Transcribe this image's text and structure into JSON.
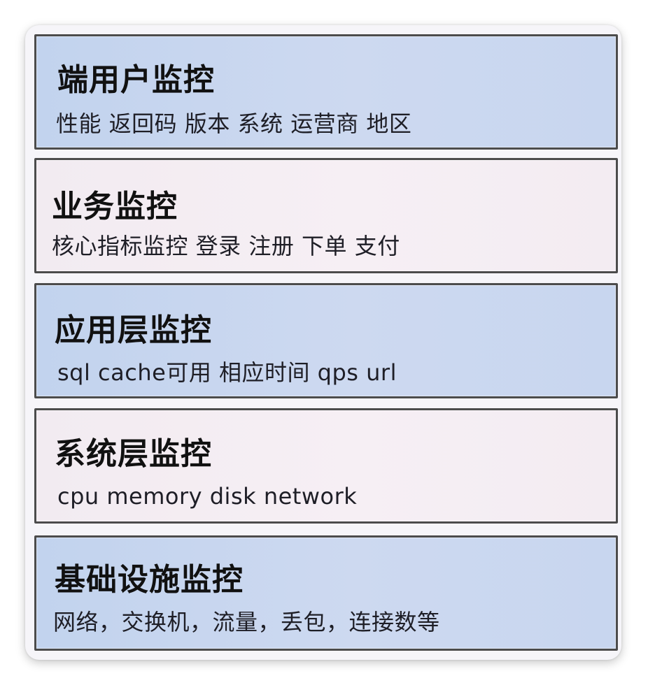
{
  "layers": [
    {
      "title": "端用户监控",
      "desc": "性能 返回码 版本 系统 运营商 地区",
      "color": "#c8d6ef"
    },
    {
      "title": "业务监控",
      "desc": "核心指标监控 登录 注册 下单 支付",
      "color": "#f4edf3"
    },
    {
      "title": "应用层监控",
      "desc": "sql cache可用 相应时间 qps url",
      "color": "#c8d6ef"
    },
    {
      "title": "系统层监控",
      "desc": "cpu memory disk network",
      "color": "#f4edf3"
    },
    {
      "title": "基础设施监控",
      "desc": "网络，交换机，流量，丢包，连接数等",
      "color": "#c8d6ef"
    }
  ]
}
